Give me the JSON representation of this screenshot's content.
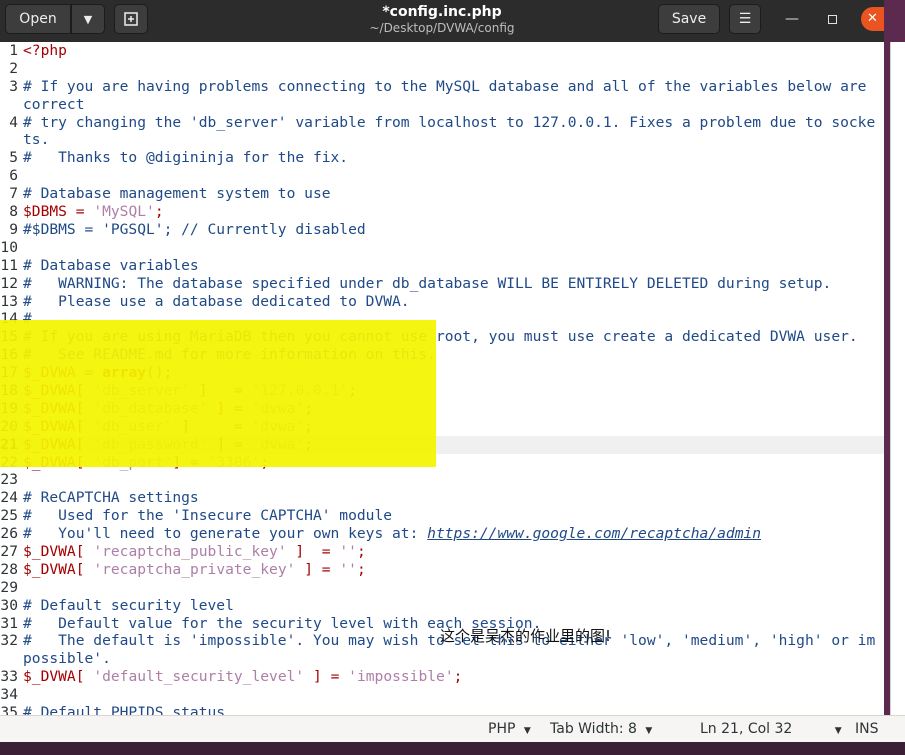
{
  "headerbar": {
    "open_label": "Open",
    "title": "*config.inc.php",
    "subtitle": "~/Desktop/DVWA/config",
    "save_label": "Save"
  },
  "colors": {
    "keyword": "#a40000",
    "string": "#ad7fa8",
    "comment": "#204a87",
    "variable": "#a40000",
    "highlight": "#f4f400",
    "url": "#204a87"
  },
  "editor": {
    "current_line": 21,
    "lines": [
      {
        "n": "1",
        "c": "<?php"
      },
      {
        "n": "2",
        "c": ""
      },
      {
        "n": "3",
        "c": "# If you are having problems connecting to the MySQL database and all of the variables below are correct"
      },
      {
        "n": "4",
        "c": "# try changing the 'db_server' variable from localhost to 127.0.0.1. Fixes a problem due to sockets."
      },
      {
        "n": "5",
        "c": "#   Thanks to @digininja for the fix."
      },
      {
        "n": "6",
        "c": ""
      },
      {
        "n": "7",
        "c": "# Database management system to use"
      },
      {
        "n": "8",
        "c": "$DBMS = 'MySQL';"
      },
      {
        "n": "9",
        "c": "#$DBMS = 'PGSQL'; // Currently disabled"
      },
      {
        "n": "10",
        "c": ""
      },
      {
        "n": "11",
        "c": "# Database variables"
      },
      {
        "n": "12",
        "c": "#   WARNING: The database specified under db_database WILL BE ENTIRELY DELETED during setup."
      },
      {
        "n": "13",
        "c": "#   Please use a database dedicated to DVWA."
      },
      {
        "n": "14",
        "c": "#"
      },
      {
        "n": "15",
        "c": "# If you are using MariaDB then you cannot use root, you must use create a dedicated DVWA user."
      },
      {
        "n": "16",
        "c": "#   See README.md for more information on this."
      },
      {
        "n": "17",
        "c": "$_DVWA = array();"
      },
      {
        "n": "18",
        "c": "$_DVWA[ 'db_server' ]   = '127.0.0.1';"
      },
      {
        "n": "19",
        "c": "$_DVWA[ 'db_database' ] = 'dvwa';"
      },
      {
        "n": "20",
        "c": "$_DVWA[ 'db_user' ]     = 'dvwa';"
      },
      {
        "n": "21",
        "c": "$_DVWA[ 'db_password' ] = 'dvwa';"
      },
      {
        "n": "22",
        "c": "$_DVWA[ 'db_port'] = '3306';"
      },
      {
        "n": "23",
        "c": ""
      },
      {
        "n": "24",
        "c": "# ReCAPTCHA settings"
      },
      {
        "n": "25",
        "c": "#   Used for the 'Insecure CAPTCHA' module"
      },
      {
        "n": "26",
        "c": "#   You'll need to generate your own keys at: https://www.google.com/recaptcha/admin"
      },
      {
        "n": "27",
        "c": "$_DVWA[ 'recaptcha_public_key' ]  = '';"
      },
      {
        "n": "28",
        "c": "$_DVWA[ 'recaptcha_private_key' ] = '';"
      },
      {
        "n": "29",
        "c": ""
      },
      {
        "n": "30",
        "c": "# Default security level"
      },
      {
        "n": "31",
        "c": "#   Default value for the security level with each session."
      },
      {
        "n": "32",
        "c": "#   The default is 'impossible'. You may wish to set this to either 'low', 'medium', 'high' or impossible'."
      },
      {
        "n": "33",
        "c": "$_DVWA[ 'default_security_level' ] = 'impossible';"
      },
      {
        "n": "34",
        "c": ""
      },
      {
        "n": "35",
        "c": "# Default PHPIDS status"
      }
    ]
  },
  "overlay_note": "这个是吴杰的作业里的图!",
  "statusbar": {
    "language": "PHP",
    "tab_width": "Tab Width: 8",
    "position": "Ln 21, Col 32",
    "mode": "INS"
  }
}
